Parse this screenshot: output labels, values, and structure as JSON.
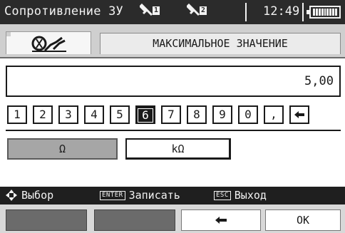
{
  "statusbar": {
    "title": "Сопротивление ЗУ",
    "probe1": "1",
    "probe2": "2",
    "clock": "12:49"
  },
  "header": {
    "heading": "МАКСИМАЛЬНОЕ ЗНАЧЕНИЕ"
  },
  "display": {
    "value": "5,00"
  },
  "keypad": {
    "keys": [
      "1",
      "2",
      "3",
      "4",
      "5",
      "6",
      "7",
      "8",
      "9",
      "0",
      ","
    ],
    "selected": "6"
  },
  "units": {
    "ohm": "Ω",
    "kohm": "kΩ",
    "active": "Ω"
  },
  "hints": {
    "select_label": "Выбор",
    "enter_key": "ENTER",
    "enter_label": "Записать",
    "esc_key": "ESC",
    "esc_label": "Выход"
  },
  "softkeys": {
    "ok_label": "OK"
  },
  "colors": {
    "statusbar": "#2b2b2b",
    "header": "#cfcfcf",
    "active_unit": "#a6a6a6",
    "softkey_dark": "#6b6b6b"
  }
}
